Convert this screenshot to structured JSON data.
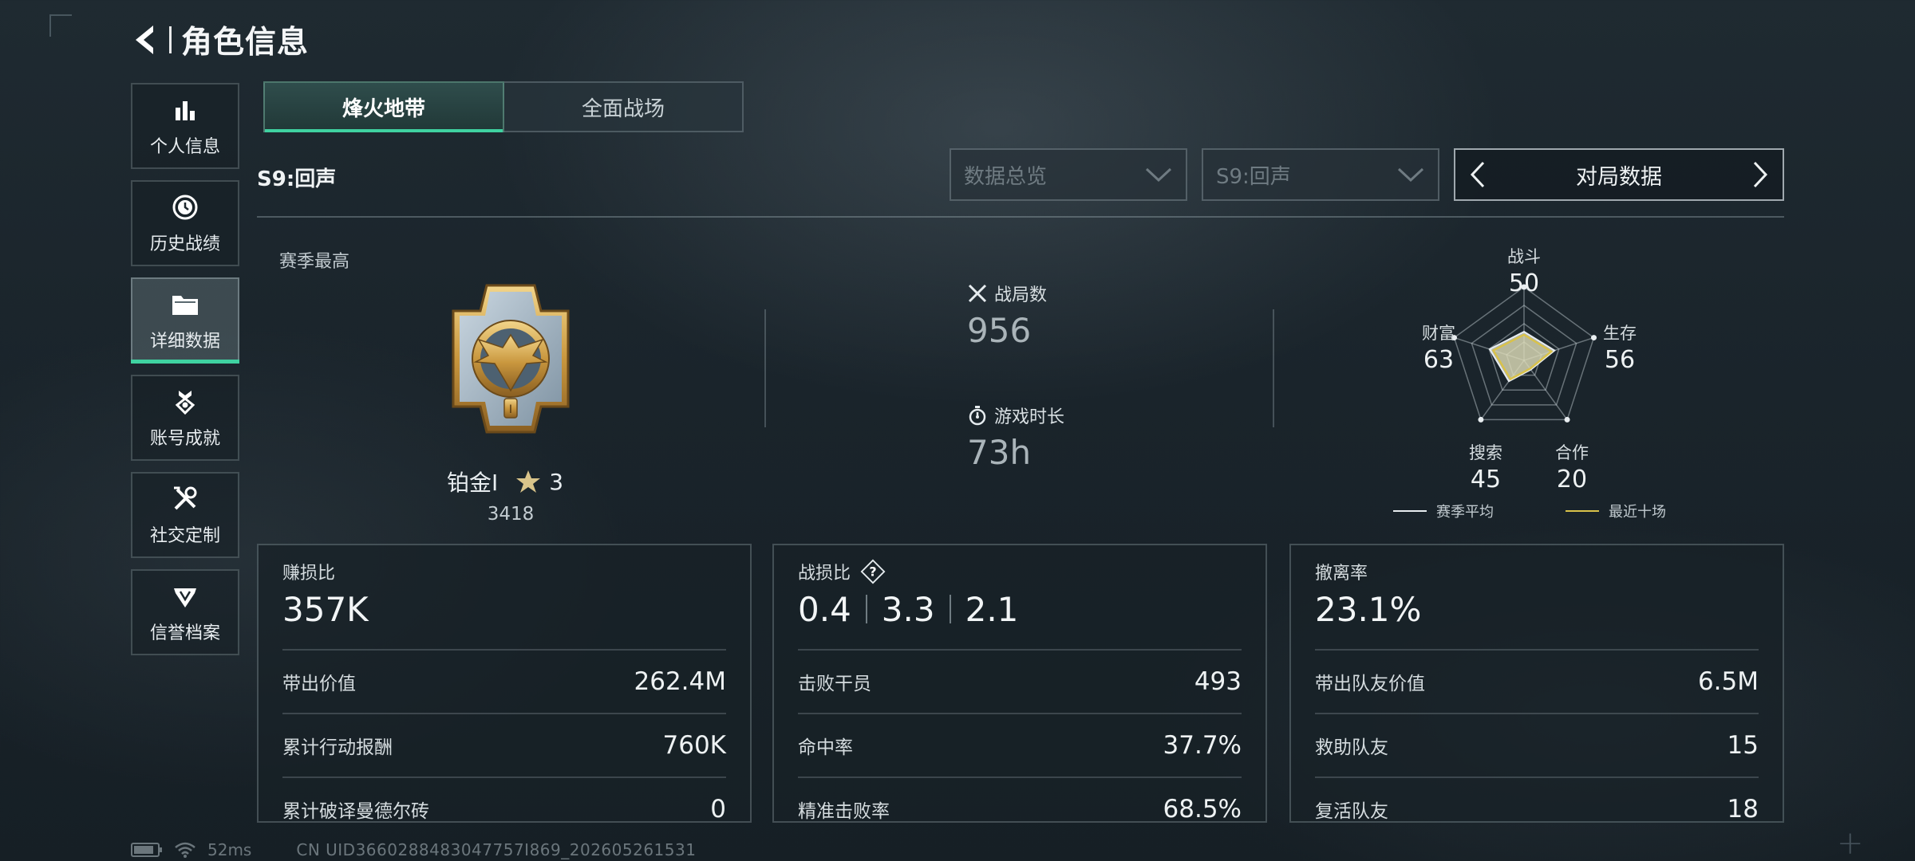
{
  "header": {
    "title": "角色信息"
  },
  "sidebar": {
    "items": [
      {
        "label": "个人信息"
      },
      {
        "label": "历史战绩"
      },
      {
        "label": "详细数据"
      },
      {
        "label": "账号成就"
      },
      {
        "label": "社交定制"
      },
      {
        "label": "信誉档案"
      }
    ],
    "active_index": 2
  },
  "tabs": [
    {
      "label": "烽火地带",
      "active": true
    },
    {
      "label": "全面战场",
      "active": false
    }
  ],
  "season": {
    "label": "S9:回声"
  },
  "filters": {
    "data_dropdown": "数据总览",
    "season_dropdown": "S9:回声",
    "switcher_label": "对局数据"
  },
  "season_highest": {
    "label": "赛季最高",
    "rank": "铂金I",
    "stars": "3",
    "score": "3418"
  },
  "stats": {
    "matches": {
      "label": "战局数",
      "value": "956"
    },
    "playtime": {
      "label": "游戏时长",
      "value": "73h"
    }
  },
  "radar": {
    "axes": [
      {
        "label": "战斗",
        "value": "50",
        "num": 50
      },
      {
        "label": "生存",
        "value": "56",
        "num": 56
      },
      {
        "label": "合作",
        "value": "20",
        "num": 20
      },
      {
        "label": "搜索",
        "value": "45",
        "num": 45
      },
      {
        "label": "财富",
        "value": "63",
        "num": 63
      }
    ],
    "legend": {
      "season_avg": "赛季平均",
      "recent_ten": "最近十场"
    },
    "colors": {
      "season_avg": "#e8edf0",
      "recent_ten": "#d9c24a"
    }
  },
  "cards": {
    "profit": {
      "title": "赚损比",
      "main": "357K",
      "rows": [
        {
          "label": "带出价值",
          "value": "262.4M"
        },
        {
          "label": "累计行动报酬",
          "value": "760K"
        },
        {
          "label": "累计破译曼德尔砖",
          "value": "0"
        }
      ]
    },
    "combat": {
      "title": "战损比",
      "main_values": [
        "0.4",
        "3.3",
        "2.1"
      ],
      "rows": [
        {
          "label": "击败干员",
          "value": "493"
        },
        {
          "label": "命中率",
          "value": "37.7%"
        },
        {
          "label": "精准击败率",
          "value": "68.5%"
        }
      ]
    },
    "extract": {
      "title": "撤离率",
      "main": "23.1%",
      "rows": [
        {
          "label": "带出队友价值",
          "value": "6.5M"
        },
        {
          "label": "救助队友",
          "value": "15"
        },
        {
          "label": "复活队友",
          "value": "18"
        }
      ]
    }
  },
  "footer": {
    "ping": "52ms",
    "uid": "CN UID3660288483047757I869_202605261531"
  },
  "theme": {
    "accent": "#3fd2a1"
  }
}
